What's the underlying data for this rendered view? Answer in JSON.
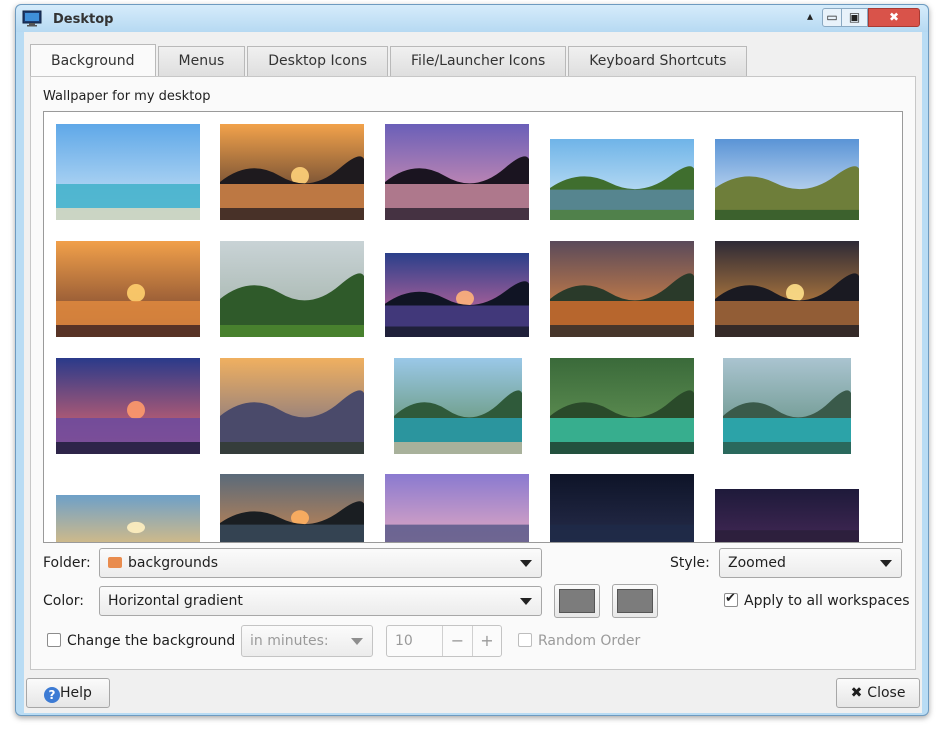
{
  "window": {
    "title": "Desktop"
  },
  "window_controls": {
    "up": "▴",
    "minimize": "▭",
    "maximize": "▣",
    "close": "✖"
  },
  "tabs": [
    {
      "label": "Background",
      "active": true
    },
    {
      "label": "Menus",
      "active": false
    },
    {
      "label": "Desktop Icons",
      "active": false
    },
    {
      "label": "File/Launcher Icons",
      "active": false
    },
    {
      "label": "Keyboard Shortcuts",
      "active": false
    }
  ],
  "background": {
    "wallpaper_label": "Wallpaper for my desktop",
    "wallpapers": [
      "beach-palms",
      "sunset-boat-lagoon",
      "purple-sunset-palms",
      "green-hills-river",
      "chocolate-hills",
      "sailboats-sunset",
      "rice-field-palms",
      "island-dusk",
      "orange-sunset-clouds",
      "golden-sunset-bay",
      "pink-sunset-boat",
      "misty-mountains",
      "lagoon-cliffs",
      "green-river-cave",
      "aerial-turquoise-bay",
      "sky-sunset-clouds",
      "dark-sunset-island",
      "city-skyline-dusk",
      "night-city-harbor",
      "night-city-lights"
    ],
    "folder": {
      "label": "Folder:",
      "value": "backgrounds"
    },
    "style": {
      "label": "Style:",
      "value": "Zoomed"
    },
    "color": {
      "label": "Color:",
      "value": "Horizontal gradient",
      "swatch1": "#7c7c7c",
      "swatch2": "#7c7c7c"
    },
    "apply_all": {
      "label": "Apply to all workspaces",
      "checked": true
    },
    "change_bg": {
      "label": "Change the background",
      "checked": false
    },
    "interval": {
      "value": "in minutes:"
    },
    "minutes": {
      "value": "10",
      "minus": "−",
      "plus": "+"
    },
    "random_order": {
      "label": "Random Order",
      "checked": false
    }
  },
  "buttons": {
    "help": "Help",
    "help_icon": "?",
    "close": "Close",
    "close_icon": "✖"
  }
}
